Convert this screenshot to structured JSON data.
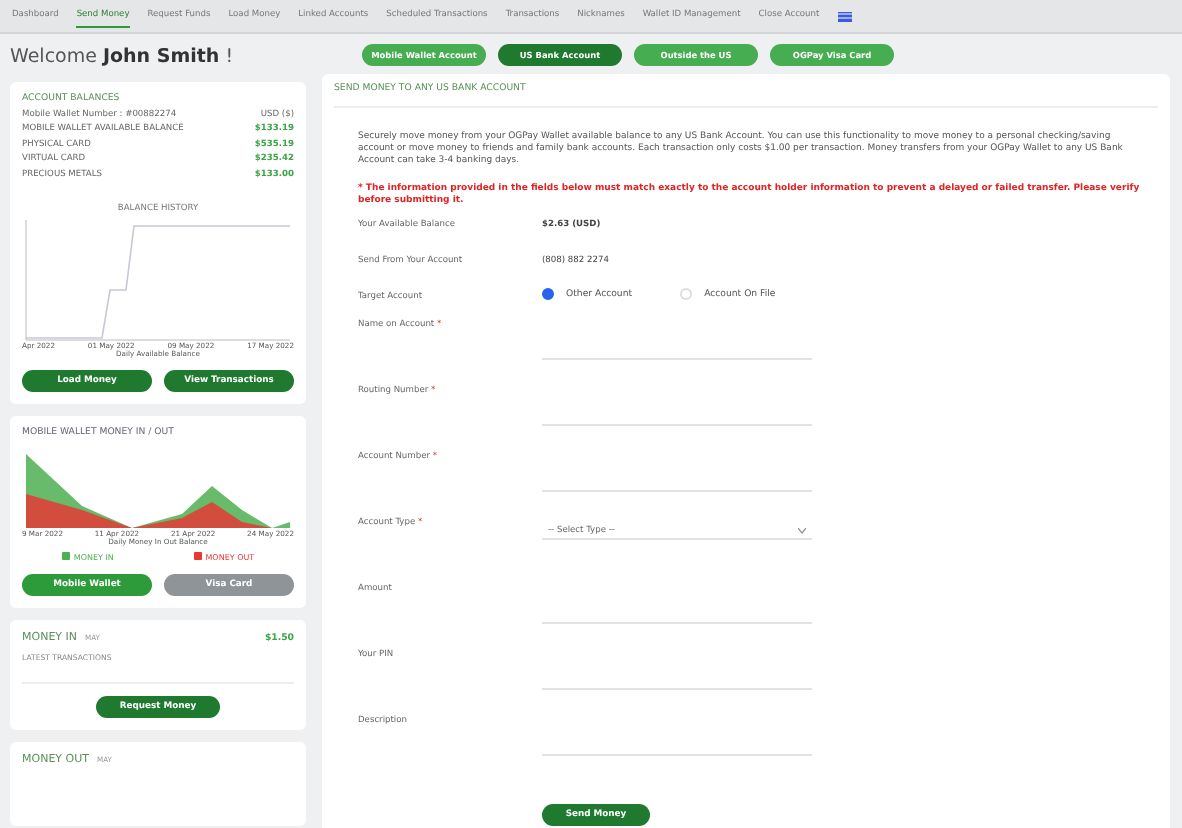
{
  "nav": {
    "items": [
      {
        "label": "Dashboard",
        "selected": false
      },
      {
        "label": "Send Money",
        "selected": true
      },
      {
        "label": "Request Funds",
        "selected": false
      },
      {
        "label": "Load Money",
        "selected": false
      },
      {
        "label": "Linked Accounts",
        "selected": false
      },
      {
        "label": "Scheduled Transactions",
        "selected": false
      },
      {
        "label": "Transactions",
        "selected": false
      },
      {
        "label": "Nicknames",
        "selected": false
      },
      {
        "label": "Wallet ID Management",
        "selected": false
      },
      {
        "label": "Close Account",
        "selected": false
      }
    ]
  },
  "welcome": "Welcome **John Smith** !",
  "balances": {
    "title": "ACCOUNT BALANCES",
    "rows": [
      {
        "label": "Mobile Wallet Number : #00882274",
        "value": "USD ($)",
        "kind": "plain"
      },
      {
        "label": "MOBILE WALLET AVAILABLE BALANCE",
        "value": "$133.19",
        "kind": "money"
      },
      {
        "label": "PHYSICAL CARD",
        "value": "$535.19",
        "kind": "money"
      },
      {
        "label": "VIRTUAL CARD",
        "value": "$235.42",
        "kind": "money"
      },
      {
        "label": "PRECIOUS METALS",
        "value": "$133.00",
        "kind": "money"
      }
    ],
    "chart_title": "BALANCE HISTORY",
    "x_labels": [
      "Apr 2022",
      "01 May 2022",
      "09 May 2022",
      "17 May 2022"
    ],
    "x_title": "Daily Available Balance",
    "buttons": [
      "Load Money",
      "View Transactions"
    ]
  },
  "wallet": {
    "title": "MOBILE WALLET MONEY IN / OUT",
    "x_labels": [
      "9 Mar 2022",
      "11 Apr 2022",
      "21 Apr 2022",
      "24 May 2022"
    ],
    "x_title": "Daily Money In Out Balance",
    "legend": [
      {
        "label": "MONEY IN",
        "color": "#4caf50"
      },
      {
        "label": "MONEY OUT",
        "color": "#e53935"
      }
    ],
    "toggles": [
      {
        "label": "Mobile Wallet",
        "selected": true
      },
      {
        "label": "Visa Card",
        "selected": false
      }
    ]
  },
  "money_in": {
    "title": "MONEY IN",
    "month": "MAY",
    "amount": "$1.50",
    "subtitle": "LATEST TRANSACTIONS",
    "button": "Request Money"
  },
  "money_out": {
    "title": "MONEY OUT",
    "month": "MAY"
  },
  "subtabs": [
    {
      "label": "Mobile Wallet Account",
      "selected": false
    },
    {
      "label": "US Bank Account",
      "selected": true
    },
    {
      "label": "Outside the US",
      "selected": false
    },
    {
      "label": "OGPay Visa Card",
      "selected": false
    }
  ],
  "form": {
    "title": "SEND MONEY TO ANY US BANK ACCOUNT",
    "intro": "Securely move money from your OGPay Wallet available balance to any US Bank Account. You can use this functionality to move money to a personal checking/saving account or move money to friends and family bank accounts. Each transaction only costs $1.00 per transaction. Money transfers from your OGPay Wallet to any US Bank Account can take 3-4 banking days.",
    "warning": "* The information provided in the fields below must match exactly to the account holder information to prevent a delayed or failed transfer. Please verify before submitting it.",
    "fields": [
      {
        "kind": "static",
        "label": "Your Available Balance",
        "value": "$2.63 (USD)",
        "bold": true
      },
      {
        "kind": "static",
        "label": "Send From Your Account",
        "value": "(808) 882 2274",
        "bold": false
      },
      {
        "kind": "radio",
        "label": "Target Account",
        "options": [
          {
            "label": "Other Account",
            "selected": true
          },
          {
            "label": "Account On File",
            "selected": false
          }
        ]
      },
      {
        "kind": "input",
        "label": "Name on Account",
        "mark": "*"
      },
      {
        "kind": "input",
        "label": "Routing Number",
        "mark": "*"
      },
      {
        "kind": "input",
        "label": "Account Number",
        "mark": "*"
      },
      {
        "kind": "select",
        "label": "Account Type",
        "mark": "*",
        "placeholder": "-- Select Type --"
      },
      {
        "kind": "input",
        "label": "Amount"
      },
      {
        "kind": "input",
        "label": "Your PIN"
      },
      {
        "kind": "input",
        "label": "Description"
      }
    ],
    "submit": "Send Money"
  }
}
